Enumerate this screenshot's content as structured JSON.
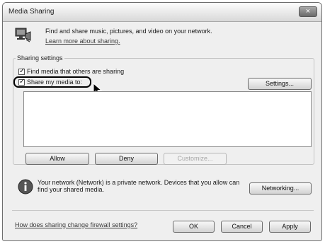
{
  "window": {
    "title": "Media Sharing",
    "close_glyph": "×"
  },
  "header": {
    "description": "Find and share music, pictures, and video on your network.",
    "learn_more": "Learn more about sharing."
  },
  "sharing_settings": {
    "label": "Sharing settings",
    "find_media": {
      "label": "Find media that others are sharing",
      "checked": true
    },
    "share_media": {
      "label": "Share my media to:",
      "checked": true
    },
    "settings_button": "Settings...",
    "devices": []
  },
  "actions": {
    "allow": "Allow",
    "deny": "Deny",
    "customize": "Customize..."
  },
  "network": {
    "message": "Your network (Network) is a private network. Devices that you allow can find your shared media.",
    "networking_button": "Networking..."
  },
  "footer": {
    "firewall_link": "How does sharing change firewall settings?",
    "ok": "OK",
    "cancel": "Cancel",
    "apply": "Apply"
  },
  "icons": {
    "header": "media-sharing-icon",
    "info": "info-icon",
    "check": "✓"
  },
  "colors": {
    "window_bg": "#efefef",
    "highlight_ring": "#000000"
  }
}
